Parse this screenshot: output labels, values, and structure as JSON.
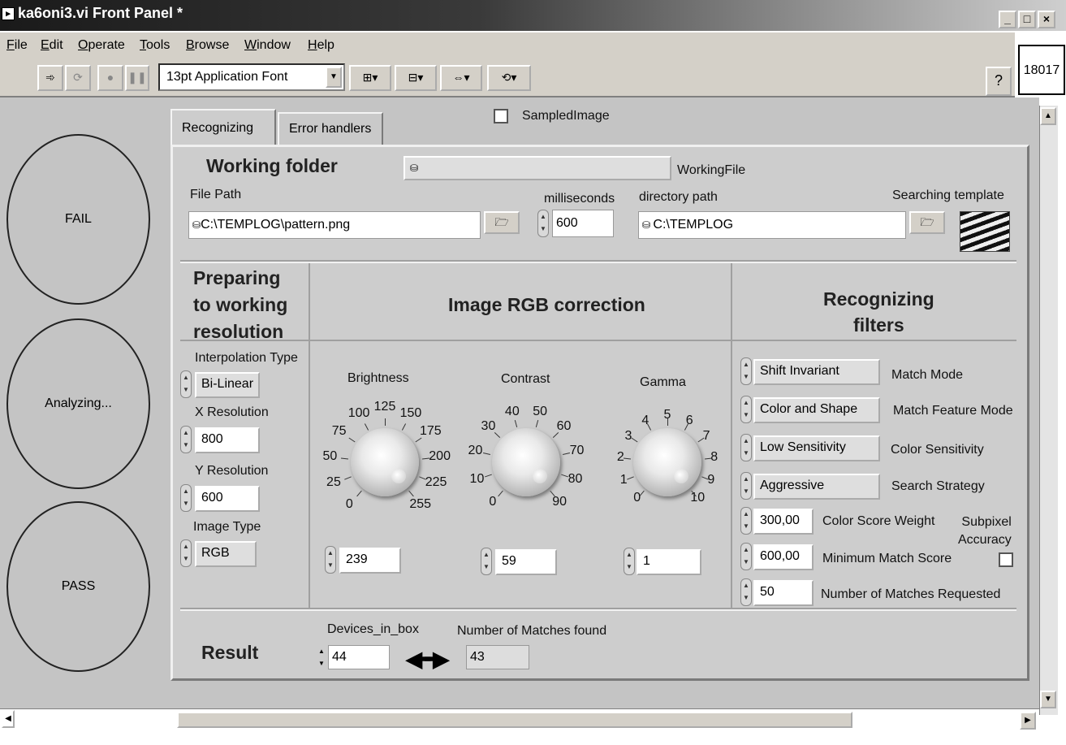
{
  "window": {
    "title": "ka6oni3.vi Front Panel *",
    "counter": "18017"
  },
  "menu": [
    {
      "u": "F",
      "rest": "ile"
    },
    {
      "u": "E",
      "rest": "dit"
    },
    {
      "u": "O",
      "rest": "perate"
    },
    {
      "u": "T",
      "rest": "ools"
    },
    {
      "u": "B",
      "rest": "rowse"
    },
    {
      "u": "W",
      "rest": "indow"
    },
    {
      "u": "H",
      "rest": "elp"
    }
  ],
  "toolbar": {
    "font": "13pt Application Font"
  },
  "leds": {
    "fail": "FAIL",
    "analyzing": "Analyzing...",
    "pass": "PASS"
  },
  "tabs": {
    "recognizing": "Recognizing",
    "errors": "Error handlers"
  },
  "sampled_image": {
    "label": "SampledImage",
    "checked": false
  },
  "working": {
    "title": "Working folder",
    "working_file_label": "WorkingFile",
    "working_file_value": "",
    "file_path_label": "File Path",
    "file_path_value": "C:\\TEMPLOG\\pattern.png",
    "ms_label": "milliseconds",
    "ms_value": "600",
    "dir_label": "directory path",
    "dir_value": "C:\\TEMPLOG",
    "template_label": "Searching template"
  },
  "preparing": {
    "title_l1": "Preparing",
    "title_l2": "to working",
    "title_l3": "resolution",
    "interp_label": "Interpolation Type",
    "interp_value": "Bi-Linear",
    "xres_label": "X Resolution",
    "xres_value": "800",
    "yres_label": "Y Resolution",
    "yres_value": "600",
    "imgtype_label": "Image Type",
    "imgtype_value": "RGB"
  },
  "rgb": {
    "title": "Image RGB correction",
    "brightness": {
      "label": "Brightness",
      "value": "239",
      "ticks": [
        "0",
        "25",
        "50",
        "75",
        "100",
        "125",
        "150",
        "175",
        "200",
        "225",
        "255"
      ]
    },
    "contrast": {
      "label": "Contrast",
      "value": "59",
      "ticks": [
        "0",
        "10",
        "20",
        "30",
        "40",
        "50",
        "60",
        "70",
        "80",
        "90"
      ]
    },
    "gamma": {
      "label": "Gamma",
      "value": "1",
      "ticks": [
        "0",
        "1",
        "2",
        "3",
        "4",
        "5",
        "6",
        "7",
        "8",
        "9",
        "10"
      ]
    }
  },
  "filters": {
    "title_l1": "Recognizing",
    "title_l2": "filters",
    "match_mode_value": "Shift Invariant",
    "match_mode_label": "Match Mode",
    "feature_value": "Color and Shape",
    "feature_label": "Match Feature Mode",
    "sensitivity_value": "Low Sensitivity",
    "sensitivity_label": "Color Sensitivity",
    "strategy_value": "Aggressive",
    "strategy_label": "Search Strategy",
    "color_weight_value": "300,00",
    "color_weight_label": "Color Score Weight",
    "subpixel_label_l1": "Subpixel",
    "subpixel_label_l2": "Accuracy",
    "subpixel_checked": false,
    "min_score_value": "600,00",
    "min_score_label": "Minimum Match Score",
    "num_matches_value": "50",
    "num_matches_label": "Number of Matches Requested"
  },
  "result": {
    "title": "Result",
    "devices_label": "Devices_in_box",
    "devices_value": "44",
    "found_label": "Number of Matches found",
    "found_value": "43"
  }
}
